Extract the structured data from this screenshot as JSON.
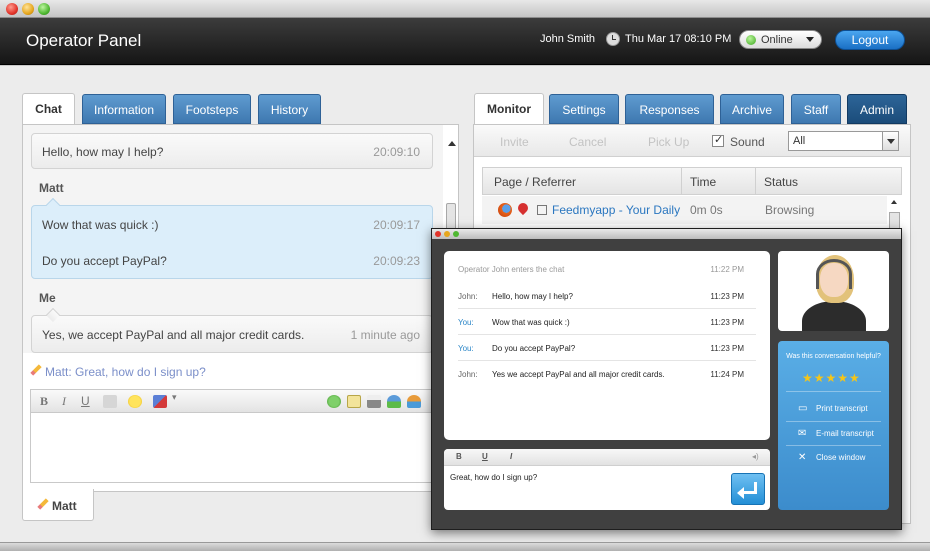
{
  "header": {
    "title": "Operator Panel",
    "user": "John Smith",
    "datetime": "Thu Mar 17 08:10 PM",
    "status": "Online",
    "logout_label": "Logout"
  },
  "left_tabs": [
    {
      "label": "Chat",
      "active": true
    },
    {
      "label": "Information"
    },
    {
      "label": "Footsteps"
    },
    {
      "label": "History"
    }
  ],
  "chat": {
    "messages": [
      {
        "sender": "",
        "text": "Hello, how may I help?",
        "time": "20:09:10"
      },
      {
        "sender": "Matt",
        "text": "Wow that was quick :)",
        "time": "20:09:17"
      },
      {
        "sender": "",
        "text": "Do you accept PayPal?",
        "time": "20:09:23"
      },
      {
        "sender": "Me",
        "text": "Yes, we accept PayPal and all major credit cards.",
        "time": "1 minute ago"
      }
    ],
    "typing": "Matt:  Great, how do I sign up?",
    "toolbar": {
      "bold": "B",
      "italic": "I",
      "underline": "U"
    },
    "bottom_tab": "Matt"
  },
  "right_tabs": [
    {
      "label": "Monitor",
      "active": true
    },
    {
      "label": "Settings"
    },
    {
      "label": "Responses"
    },
    {
      "label": "Archive"
    },
    {
      "label": "Staff"
    },
    {
      "label": "Admin"
    }
  ],
  "monitor": {
    "toolbar": {
      "invite": "Invite",
      "cancel": "Cancel",
      "pickup": "Pick Up",
      "sound": "Sound",
      "filter": "All"
    },
    "columns": [
      "Page / Referrer",
      "Time",
      "Status"
    ],
    "rows": [
      {
        "page": "Feedmyapp - Your Daily \\",
        "time": "0m 0s",
        "status": "Browsing"
      }
    ]
  },
  "float_window": {
    "system_msg": {
      "text": "Operator John enters the chat",
      "time": "11:22 PM"
    },
    "transcript": [
      {
        "sender": "John:",
        "text": "Hello, how may I help?",
        "time": "11:23 PM"
      },
      {
        "sender": "You:",
        "text": "Wow that was quick :)",
        "time": "11:23 PM"
      },
      {
        "sender": "You:",
        "text": "Do you accept PayPal?",
        "time": "11:23 PM"
      },
      {
        "sender": "John:",
        "text": "Yes we accept PayPal and all major credit cards.",
        "time": "11:24 PM"
      }
    ],
    "compose": {
      "bold": "B",
      "underline": "U",
      "italic": "I",
      "text": "Great, how do I sign up?"
    },
    "side": {
      "question": "Was this conversation helpful?",
      "stars": "★★★★★",
      "print": "Print transcript",
      "email": "E-mail transcript",
      "close": "Close window"
    }
  },
  "colors": {
    "accent": "#3e78b0",
    "admin_tab": "#1b4c7a",
    "logout": "#1a6fc4"
  }
}
